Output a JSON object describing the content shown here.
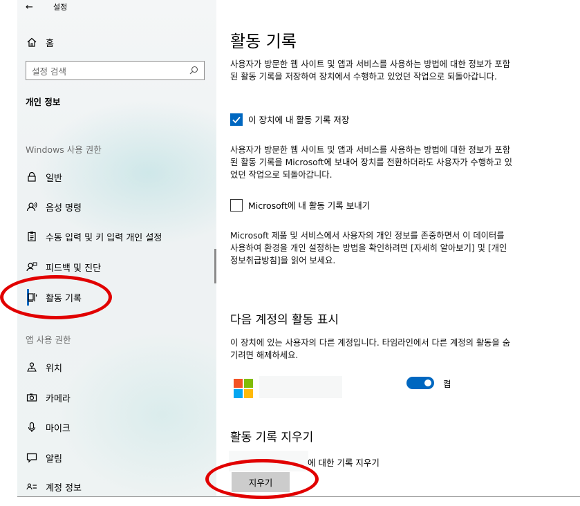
{
  "header": {
    "back_label": "설정"
  },
  "sidebar": {
    "home_label": "홈",
    "search_placeholder": "설정 검색",
    "category_title": "개인 정보",
    "windows_section": "Windows 사용 권한",
    "windows_items": [
      {
        "label": "일반",
        "icon": "lock-icon"
      },
      {
        "label": "음성 명령",
        "icon": "speech-icon"
      },
      {
        "label": "수동 입력 및 키 입력 개인 설정",
        "icon": "clipboard-icon"
      },
      {
        "label": "피드백 및 진단",
        "icon": "feedback-icon"
      },
      {
        "label": "활동 기록",
        "icon": "timeline-icon",
        "active": true
      }
    ],
    "app_section": "앱 사용 권한",
    "app_items": [
      {
        "label": "위치",
        "icon": "location-icon"
      },
      {
        "label": "카메라",
        "icon": "camera-icon"
      },
      {
        "label": "마이크",
        "icon": "microphone-icon"
      },
      {
        "label": "알림",
        "icon": "notification-icon"
      },
      {
        "label": "계정 정보",
        "icon": "account-info-icon"
      }
    ]
  },
  "main": {
    "title": "활동 기록",
    "desc1": "사용자가 방문한 웹 사이트 및 앱과 서비스를 사용하는 방법에 대한 정보가 포함된 활동 기록을 저장하여 장치에서 수행하고 있었던 작업으로 되돌아갑니다.",
    "checkbox1_label": "이 장치에 내 활동 기록 저장",
    "checkbox1_checked": true,
    "desc2": "사용자가 방문한 웹 사이트 및 앱과 서비스를 사용하는 방법에 대한 정보가 포함된 활동 기록을 Microsoft에 보내어 장치를 전환하더라도 사용자가 수행하고 있었던 작업으로 되돌아갑니다.",
    "checkbox2_label": "Microsoft에 내 활동 기록 보내기",
    "checkbox2_checked": false,
    "desc3": "Microsoft 제품 및 서비스에서 사용자의 개인 정보를 존중하면서 이 데이터를 사용하여 환경을 개인 설정하는 방법을 확인하려면 [자세히 알아보기] 및 [개인정보취급방침]을 읽어 보세요.",
    "accounts_heading": "다음 계정의 활동 표시",
    "accounts_desc": "이 장치에 있는 사용자의 다른 계정입니다. 타임라인에서 다른 계정의 활동을 숨기려면 해제하세요.",
    "toggle_label": "켬",
    "toggle_on": true,
    "clear_heading": "활동 기록 지우기",
    "clear_label": "에 대한 기록 지우기",
    "clear_button": "지우기"
  },
  "colors": {
    "accent": "#0067c0",
    "annotation": "#e10000"
  }
}
